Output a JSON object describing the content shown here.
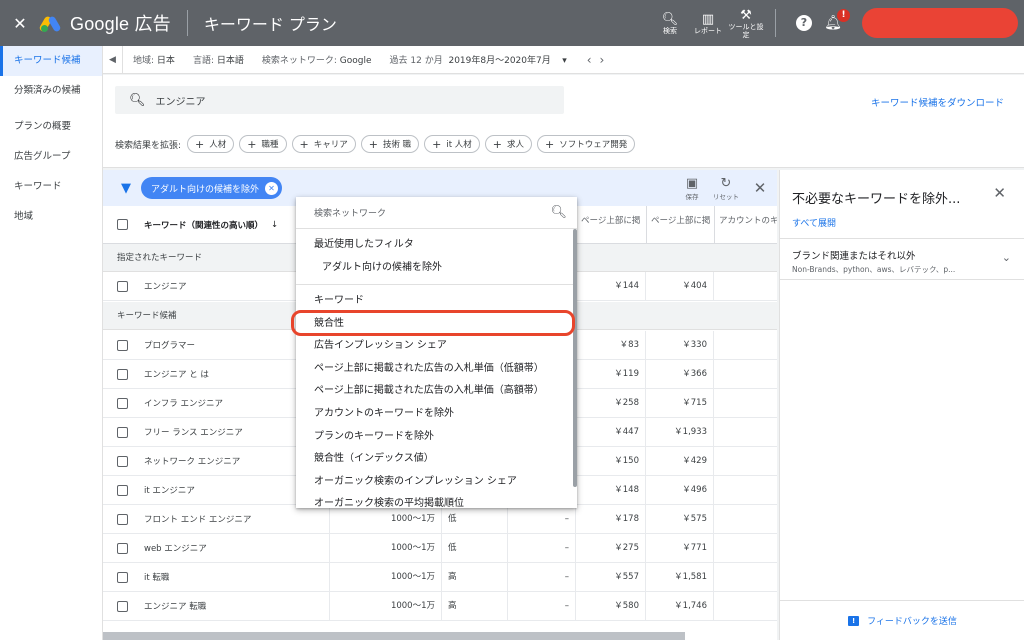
{
  "header": {
    "brand": "Google 広告",
    "title": "キーワード プラン",
    "actions": [
      {
        "icon": "search-icon",
        "label": "検索"
      },
      {
        "icon": "report-icon",
        "label": "レポート"
      },
      {
        "icon": "wrench-icon",
        "label": "ツールと設定"
      }
    ],
    "notification_badge": "!"
  },
  "leftnav": {
    "items": [
      "キーワード候補",
      "分類済みの候補",
      "プランの概要",
      "広告グループ",
      "キーワード",
      "地域"
    ],
    "active": "キーワード候補"
  },
  "filters": {
    "location_label": "地域:",
    "location_value": "日本",
    "language_label": "言語:",
    "language_value": "日本語",
    "network_label": "検索ネットワーク:",
    "network_value": "Google",
    "period_label": "過去 12 か月",
    "period_value": "2019年8月〜2020年7月"
  },
  "search": {
    "value": "エンジニア",
    "download_link": "キーワード候補をダウンロード",
    "expand_label": "検索結果を拡張:",
    "expand_chips": [
      "人材",
      "職種",
      "キャリア",
      "技術 職",
      "it 人材",
      "求人",
      "ソフトウェア開発"
    ]
  },
  "filterbar": {
    "active_chip": "アダルト向けの候補を除外",
    "save_label": "保存",
    "reset_label": "リセット"
  },
  "table": {
    "headers": {
      "keyword": "キーワード（関連性の高い順）",
      "bid_low": "ページ上部に掲",
      "bid_high": "ページ上部に掲",
      "account": "アカウントのキ"
    },
    "specified_section": "指定されたキーワード",
    "candidate_section": "キーワード候補",
    "specified_rows": [
      {
        "keyword": "エンジニア",
        "volume": "",
        "competition": "",
        "share": "",
        "low": "￥144",
        "high": "￥404"
      }
    ],
    "candidate_rows": [
      {
        "keyword": "プログラマー",
        "volume": "",
        "competition": "",
        "share": "",
        "low": "￥83",
        "high": "￥330"
      },
      {
        "keyword": "エンジニア と は",
        "volume": "",
        "competition": "",
        "share": "",
        "low": "￥119",
        "high": "￥366"
      },
      {
        "keyword": "インフラ エンジニア",
        "volume": "",
        "competition": "",
        "share": "",
        "low": "￥258",
        "high": "￥715"
      },
      {
        "keyword": "フリー ランス エンジニア",
        "volume": "",
        "competition": "",
        "share": "",
        "low": "￥447",
        "high": "￥1,933"
      },
      {
        "keyword": "ネットワーク エンジニア",
        "volume": "",
        "competition": "",
        "share": "",
        "low": "￥150",
        "high": "￥429"
      },
      {
        "keyword": "it エンジニア",
        "volume": "",
        "competition": "",
        "share": "",
        "low": "￥148",
        "high": "￥496"
      },
      {
        "keyword": "フロント エンド エンジニア",
        "volume": "1000〜1万",
        "competition": "低",
        "share": "–",
        "low": "￥178",
        "high": "￥575"
      },
      {
        "keyword": "web エンジニア",
        "volume": "1000〜1万",
        "competition": "低",
        "share": "–",
        "low": "￥275",
        "high": "￥771"
      },
      {
        "keyword": "it 転職",
        "volume": "1000〜1万",
        "competition": "高",
        "share": "–",
        "low": "￥557",
        "high": "￥1,581"
      },
      {
        "keyword": "エンジニア 転職",
        "volume": "1000〜1万",
        "competition": "高",
        "share": "–",
        "low": "￥580",
        "high": "￥1,746"
      }
    ]
  },
  "dropdown": {
    "search_placeholder": "検索ネットワーク",
    "recent_group": "最近使用したフィルタ",
    "recent_item": "アダルト向けの候補を除外",
    "options": [
      "キーワード",
      "競合性",
      "広告インプレッション シェア",
      "ページ上部に掲載された広告の入札単価（低額帯）",
      "ページ上部に掲載された広告の入札単価（高額帯）",
      "アカウントのキーワードを除外",
      "プランのキーワードを除外",
      "競合性（インデックス値）",
      "オーガニック検索のインプレッション シェア",
      "オーガニック検索の平均掲載順位"
    ],
    "highlighted": "競合性"
  },
  "rightpanel": {
    "title": "不必要なキーワードを除外...",
    "expand_all": "すべて展開",
    "section_title": "ブランド関連またはそれ以外",
    "section_sub": "Non-Brands、python、aws、レバテック、p...",
    "feedback": "フィードバックを送信"
  },
  "colors": {
    "topbar": "#5f6368",
    "accent": "#1a73e8",
    "highlight": "#e8452c",
    "account_pill": "#ea4335"
  }
}
